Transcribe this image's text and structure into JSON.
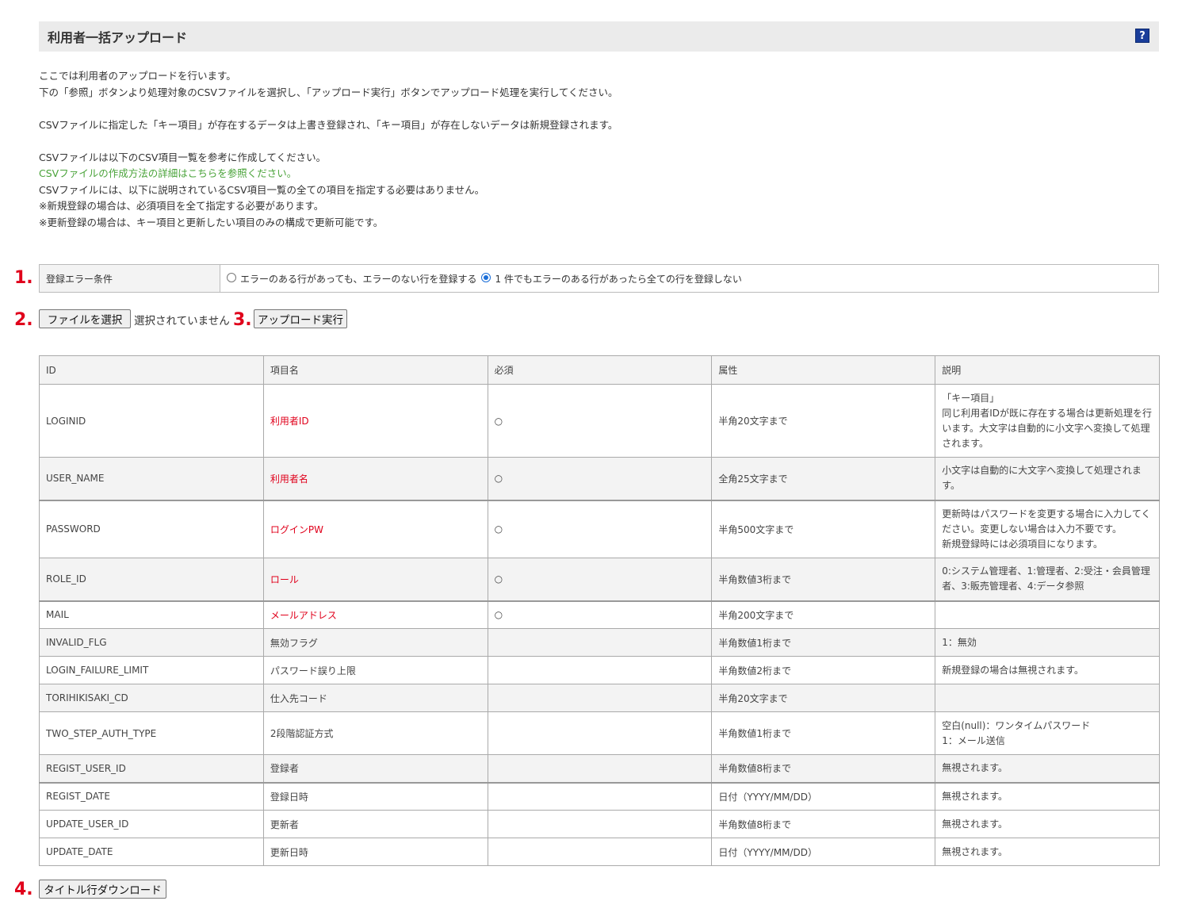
{
  "header": {
    "title": "利用者一括アップロード",
    "help": "?"
  },
  "intro": {
    "line1": "ここでは利用者のアップロードを行います。",
    "line2": "下の「参照」ボタンより処理対象のCSVファイルを選択し、「アップロード実行」ボタンでアップロード処理を実行してください。",
    "line3": "CSVファイルに指定した「キー項目」が存在するデータは上書き登録され、「キー項目」が存在しないデータは新規登録されます。",
    "line4": "CSVファイルは以下のCSV項目一覧を参考に作成してください。",
    "link": "CSVファイルの作成方法の詳細はこちらを参照ください。",
    "line5": "CSVファイルには、以下に説明されているCSV項目一覧の全ての項目を指定する必要はありません。",
    "line6": "※新規登録の場合は、必須項目を全て指定する必要があります。",
    "line7": "※更新登録の場合は、キー項目と更新したい項目のみの構成で更新可能です。"
  },
  "steps": {
    "s1": "1.",
    "s2": "2.",
    "s3": "3.",
    "s4": "4."
  },
  "error_condition": {
    "label": "登録エラー条件",
    "option1": "エラーのある行があっても、エラーのない行を登録する",
    "option2": "1 件でもエラーのある行があったら全ての行を登録しない",
    "selected": "option2"
  },
  "file": {
    "choose_label": "ファイルを選択",
    "status": "選択されていません"
  },
  "upload_button": "アップロード実行",
  "download_button": "タイトル行ダウンロード",
  "table": {
    "headers": [
      "ID",
      "項目名",
      "必須",
      "属性",
      "説明"
    ],
    "rows": [
      {
        "id": "LOGINID",
        "name": "利用者ID",
        "required": "○",
        "attr": "半角20文字まで",
        "desc": "「キー項目」\n同じ利用者IDが既に存在する場合は更新処理を行います。大文字は自動的に小文字へ変換して処理されます。"
      },
      {
        "id": "USER_NAME",
        "name": "利用者名",
        "required": "○",
        "attr": "全角25文字まで",
        "desc": "小文字は自動的に大文字へ変換して処理されます。"
      },
      {
        "id": "PASSWORD",
        "name": "ログインPW",
        "required": "○",
        "attr": "半角500文字まで",
        "desc": "更新時はパスワードを変更する場合に入力してください。変更しない場合は入力不要です。\n新規登録時には必須項目になります。"
      },
      {
        "id": "ROLE_ID",
        "name": "ロール",
        "required": "○",
        "attr": "半角数値3桁まで",
        "desc": "0:システム管理者、1:管理者、2:受注・会員管理者、3:販売管理者、4:データ参照"
      },
      {
        "id": "MAIL",
        "name": "メールアドレス",
        "required": "○",
        "attr": "半角200文字まで",
        "desc": ""
      },
      {
        "id": "INVALID_FLG",
        "name": "無効フラグ",
        "required": "",
        "attr": "半角数値1桁まで",
        "desc": "1：無効"
      },
      {
        "id": "LOGIN_FAILURE_LIMIT",
        "name": "パスワード誤り上限",
        "required": "",
        "attr": "半角数値2桁まで",
        "desc": "新規登録の場合は無視されます。"
      },
      {
        "id": "TORIHIKISAKI_CD",
        "name": "仕入先コード",
        "required": "",
        "attr": "半角20文字まで",
        "desc": ""
      },
      {
        "id": "TWO_STEP_AUTH_TYPE",
        "name": "2段階認証方式",
        "required": "",
        "attr": "半角数値1桁まで",
        "desc": "空白(null)：ワンタイムパスワード\n1：メール送信"
      },
      {
        "id": "REGIST_USER_ID",
        "name": "登録者",
        "required": "",
        "attr": "半角数値8桁まで",
        "desc": "無視されます。"
      },
      {
        "id": "REGIST_DATE",
        "name": "登録日時",
        "required": "",
        "attr": "日付（YYYY/MM/DD）",
        "desc": "無視されます。"
      },
      {
        "id": "UPDATE_USER_ID",
        "name": "更新者",
        "required": "",
        "attr": "半角数値8桁まで",
        "desc": "無視されます。"
      },
      {
        "id": "UPDATE_DATE",
        "name": "更新日時",
        "required": "",
        "attr": "日付（YYYY/MM/DD）",
        "desc": "無視されます。"
      }
    ]
  }
}
